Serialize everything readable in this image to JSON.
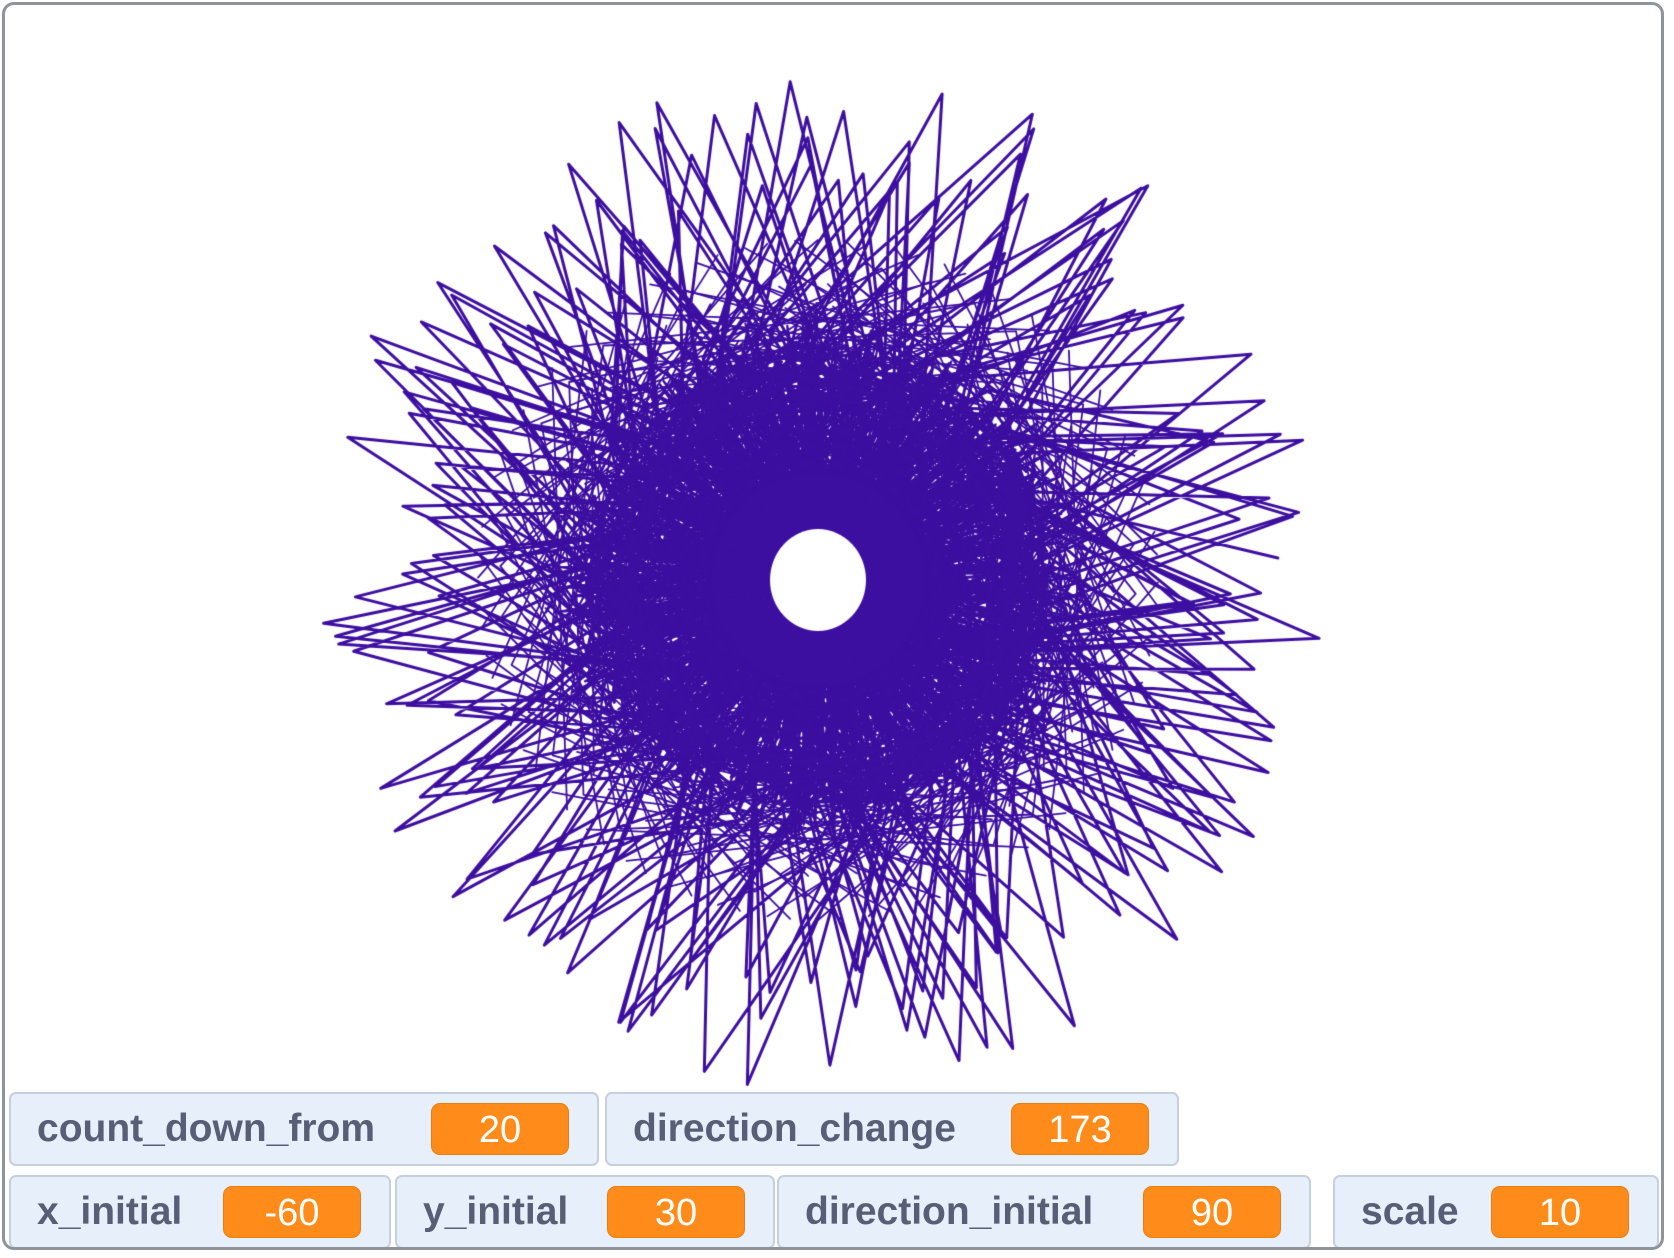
{
  "stage": {
    "pen_color": "#3d0fa0",
    "background_color": "#ffffff",
    "drawing": "pen spirograph pattern"
  },
  "monitors": [
    {
      "label": "count_down_from",
      "value": "20"
    },
    {
      "label": "direction_change",
      "value": "173"
    },
    {
      "label": "x_initial",
      "value": "-60"
    },
    {
      "label": "y_initial",
      "value": "30"
    },
    {
      "label": "direction_initial",
      "value": "90"
    },
    {
      "label": "scale",
      "value": "10"
    }
  ]
}
